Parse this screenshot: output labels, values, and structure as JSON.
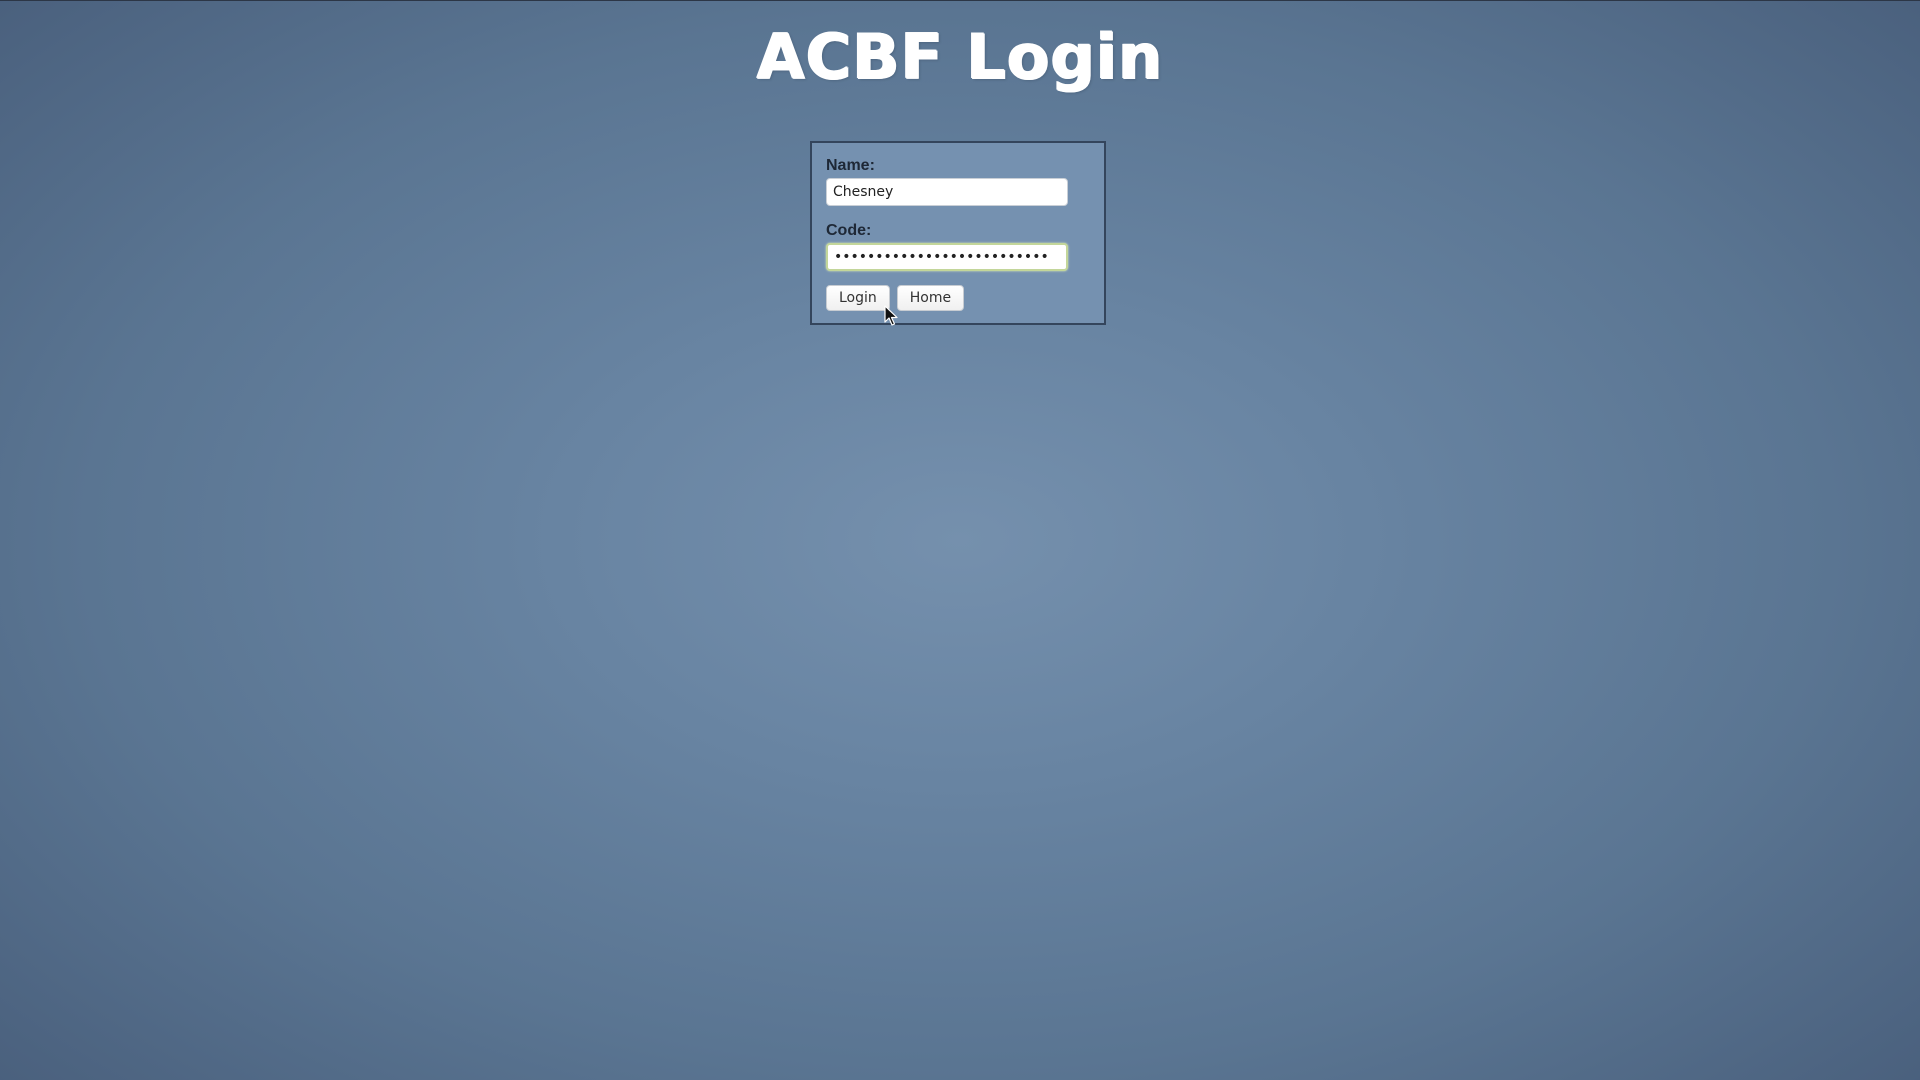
{
  "page": {
    "title": "ACBF Login"
  },
  "form": {
    "name_label": "Name:",
    "name_value": "Chesney",
    "code_label": "Code:",
    "code_value": "••••••••••••••••••••••••••",
    "login_button": "Login",
    "home_button": "Home"
  },
  "colors": {
    "background_center": "#7590ad",
    "background_edge": "#495f7c",
    "panel_background": "#7591b0",
    "panel_border": "#34455c",
    "focus_ring": "#c3d69a"
  },
  "icons": {
    "cursor": "mouse-pointer-icon"
  }
}
